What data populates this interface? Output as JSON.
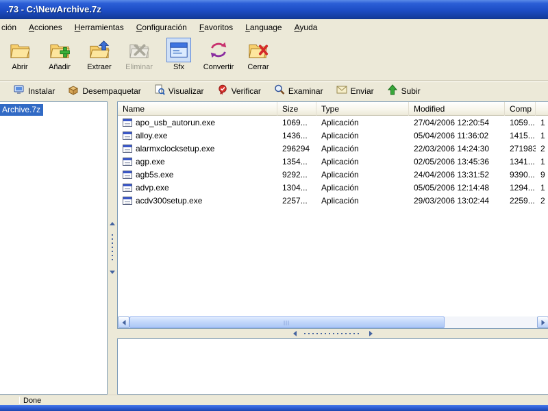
{
  "window": {
    "title": ".73 - C:\\NewArchive.7z"
  },
  "menu": {
    "items": [
      {
        "label": "ción"
      },
      {
        "label": "Acciones"
      },
      {
        "label": "Herramientas"
      },
      {
        "label": "Configuración"
      },
      {
        "label": "Favoritos"
      },
      {
        "label": "Language"
      },
      {
        "label": "Ayuda"
      }
    ]
  },
  "toolbar": {
    "buttons": [
      {
        "label": "Abrir"
      },
      {
        "label": "Añadir"
      },
      {
        "label": "Extraer"
      },
      {
        "label": "Eliminar",
        "state": "disabled"
      },
      {
        "label": "Sfx",
        "state": "selected"
      },
      {
        "label": "Convertir"
      },
      {
        "label": "Cerrar"
      }
    ]
  },
  "toolbar2": {
    "buttons": [
      {
        "label": "Instalar"
      },
      {
        "label": "Desempaquetar"
      },
      {
        "label": "Visualizar"
      },
      {
        "label": "Verificar"
      },
      {
        "label": "Examinar"
      },
      {
        "label": "Enviar"
      },
      {
        "label": "Subir"
      }
    ]
  },
  "tree": {
    "selected_item": "Archive.7z"
  },
  "list": {
    "columns": [
      "Name",
      "Size",
      "Type",
      "Modified",
      "Comp"
    ],
    "rows": [
      {
        "name": "apo_usb_autorun.exe",
        "size": "1069...",
        "type": "Aplicación",
        "modified": "27/04/2006 12:20:54",
        "comp": "1059...",
        "extra": "1"
      },
      {
        "name": "alloy.exe",
        "size": "1436...",
        "type": "Aplicación",
        "modified": "05/04/2006 11:36:02",
        "comp": "1415...",
        "extra": "1"
      },
      {
        "name": "alarmxclocksetup.exe",
        "size": "296294",
        "type": "Aplicación",
        "modified": "22/03/2006 14:24:30",
        "comp": "271983",
        "extra": "2"
      },
      {
        "name": "agp.exe",
        "size": "1354...",
        "type": "Aplicación",
        "modified": "02/05/2006 13:45:36",
        "comp": "1341...",
        "extra": "1"
      },
      {
        "name": "agb5s.exe",
        "size": "9292...",
        "type": "Aplicación",
        "modified": "24/04/2006 13:31:52",
        "comp": "9390...",
        "extra": "9"
      },
      {
        "name": "advp.exe",
        "size": "1304...",
        "type": "Aplicación",
        "modified": "05/05/2006 12:14:48",
        "comp": "1294...",
        "extra": "1"
      },
      {
        "name": "acdv300setup.exe",
        "size": "2257...",
        "type": "Aplicación",
        "modified": "29/03/2006 13:02:44",
        "comp": "2259...",
        "extra": "2"
      }
    ]
  },
  "statusbar": {
    "text": "Done"
  },
  "colors": {
    "titlebar": "#1c4cc4",
    "toolbar_bg": "#ece9d8",
    "selection": "#316ac5",
    "panel_border": "#7f9db9",
    "scroll_thumb": "#c3d8fb"
  }
}
